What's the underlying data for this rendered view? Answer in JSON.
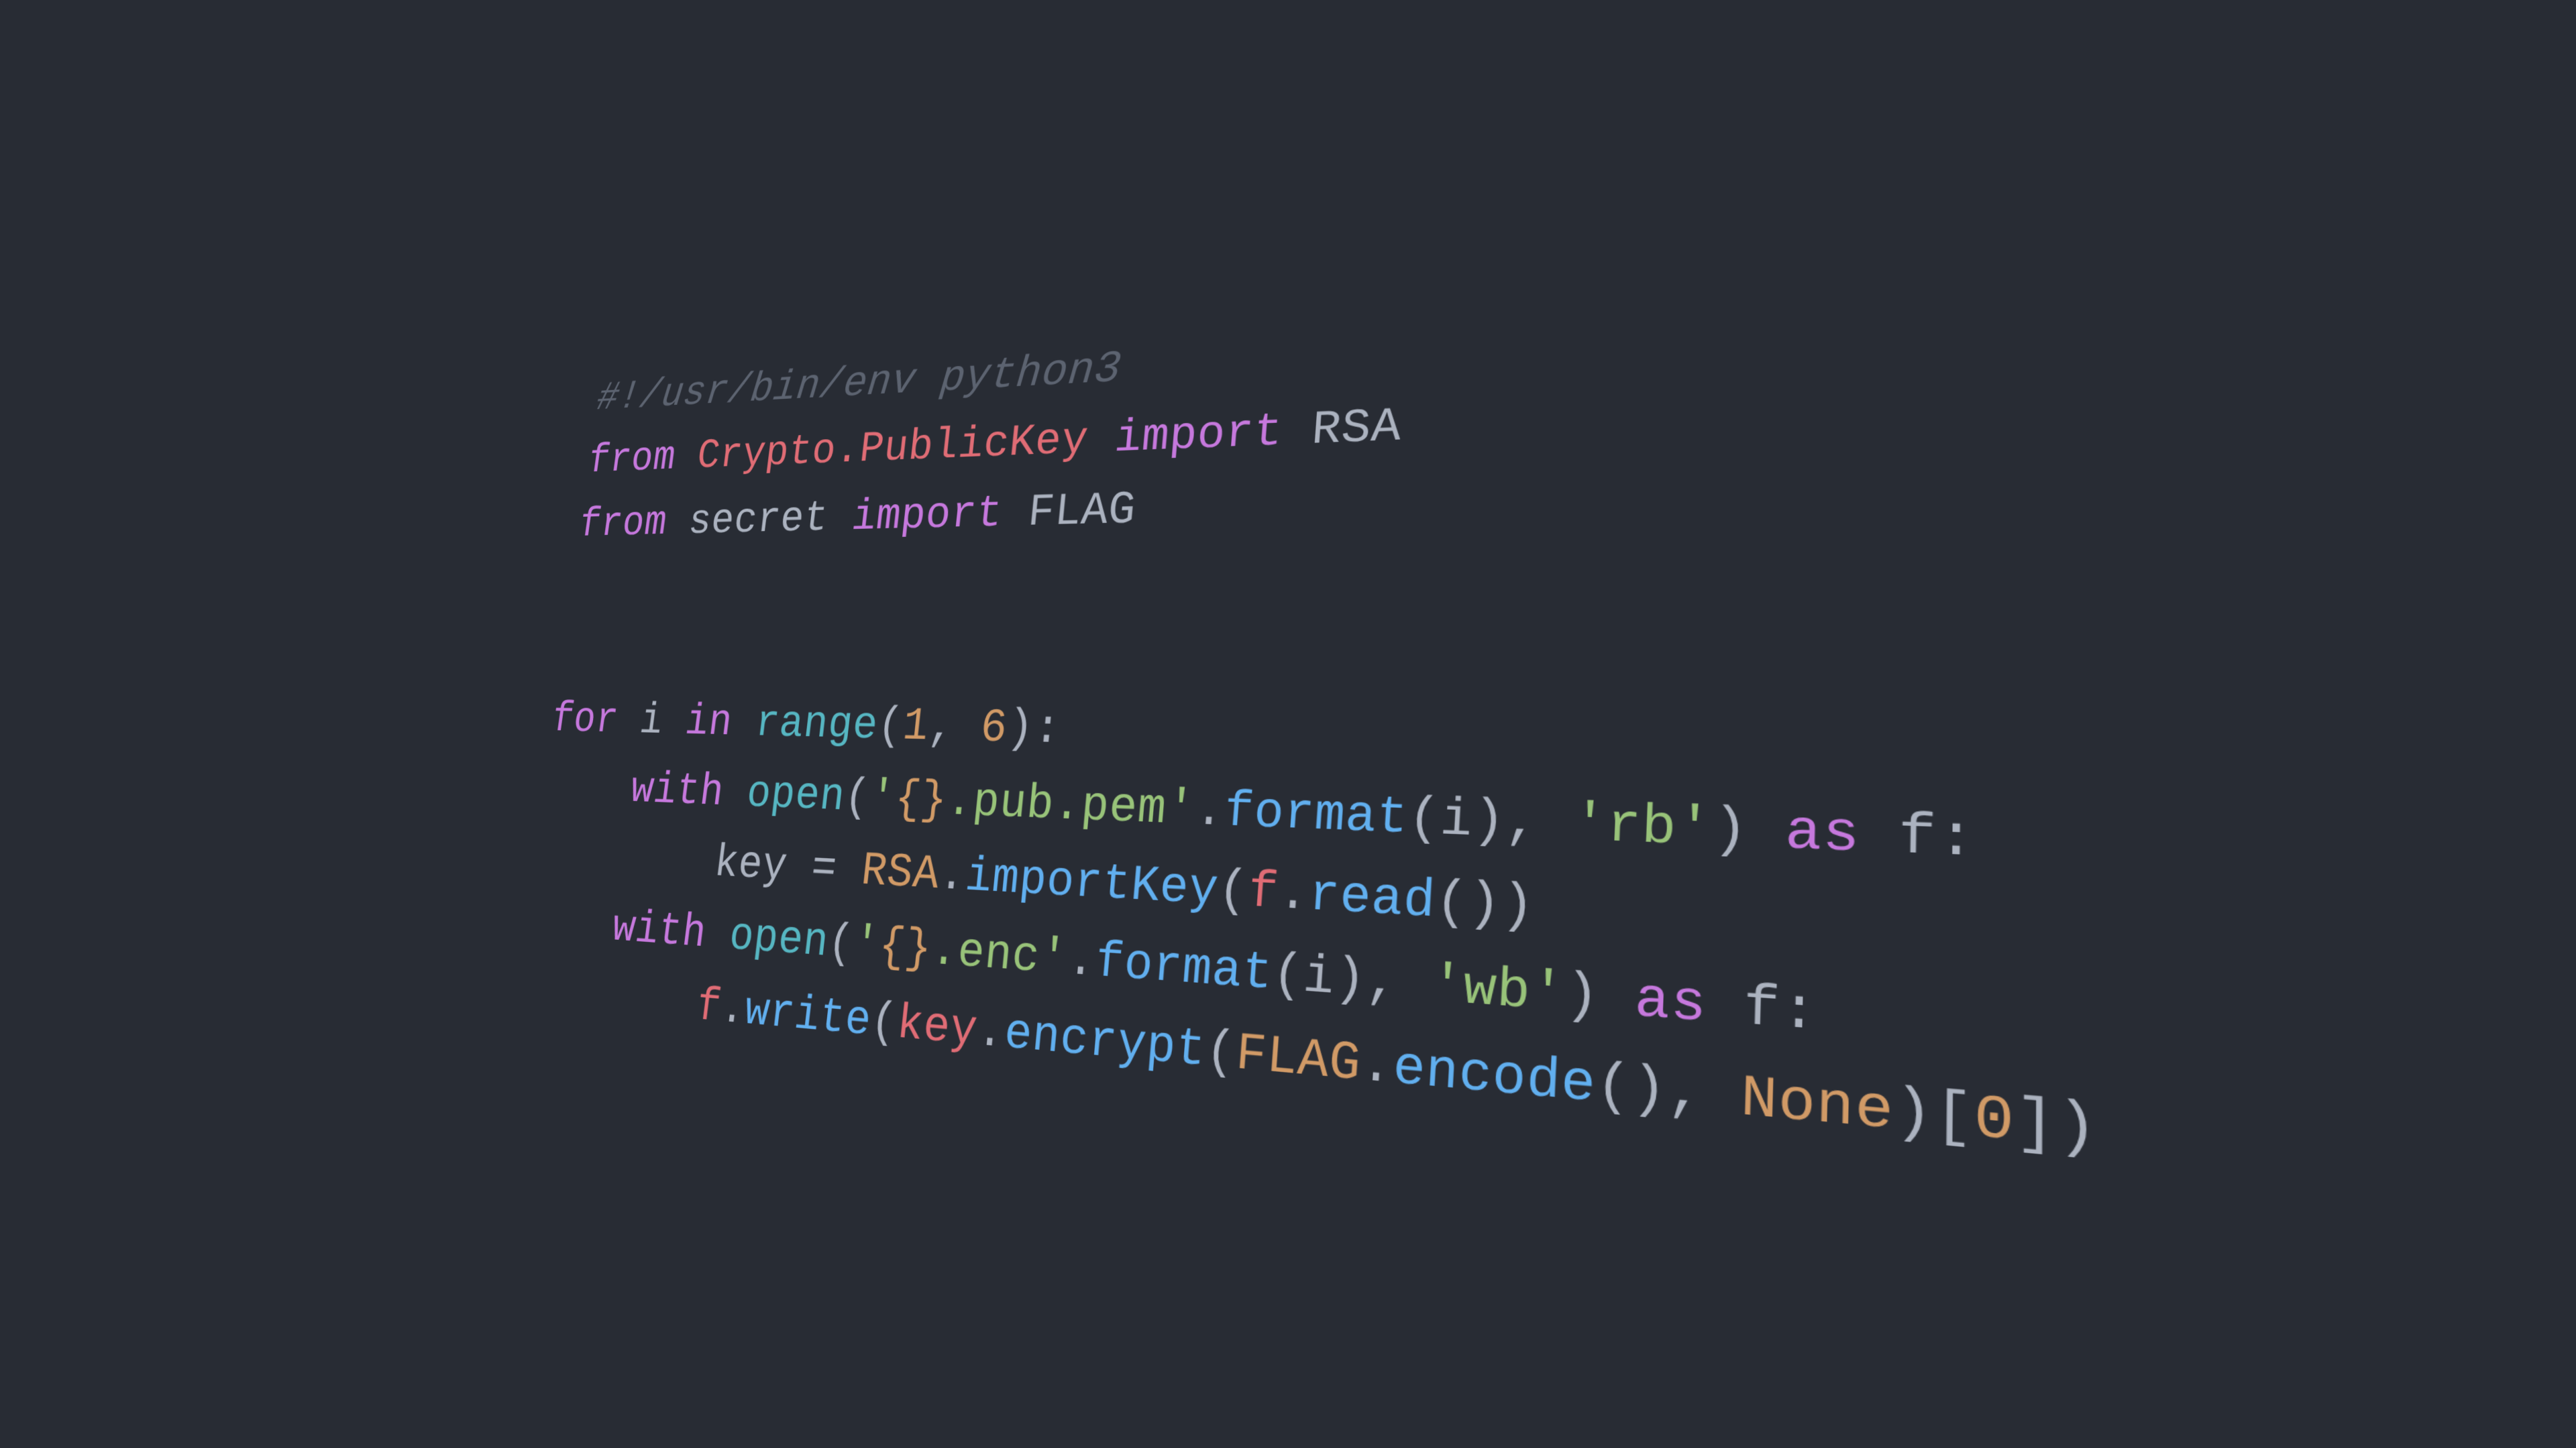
{
  "wallpaper": {
    "background_color": "#282c34",
    "language": "python",
    "theme": "one-dark"
  },
  "palette": {
    "background": "#282c34",
    "comment": "#5c6370",
    "keyword": "#c678dd",
    "module": "#e06c75",
    "variable": "#e06c75",
    "builtin": "#56b6c2",
    "function": "#61afef",
    "string": "#98c379",
    "number": "#d19a66",
    "constant": "#d19a66",
    "class": "#d19a66",
    "format_placeholder": "#d19a66",
    "default_text": "#abb2bf"
  },
  "code": {
    "full_text": "#!/usr/bin/env python3\nfrom Crypto.PublicKey import RSA\nfrom secret import FLAG\n\n\nfor i in range(1, 6):\n    with open('{}.pub.pem'.format(i), 'rb') as f:\n        key = RSA.importKey(f.read())\n    with open('{}.enc'.format(i), 'wb') as f:\n        f.write(key.encrypt(FLAG.encode(), None)[0])",
    "lines": [
      {
        "n": 1,
        "text": "#!/usr/bin/env python3",
        "tokens": [
          {
            "t": "#!/usr/bin/env python3",
            "c": "comment"
          }
        ]
      },
      {
        "n": 2,
        "text": "from Crypto.PublicKey import RSA",
        "tokens": [
          {
            "t": "from",
            "c": "keyword"
          },
          {
            "t": " ",
            "c": "plain"
          },
          {
            "t": "Crypto.PublicKey",
            "c": "module"
          },
          {
            "t": " ",
            "c": "plain"
          },
          {
            "t": "import",
            "c": "keyword"
          },
          {
            "t": " ",
            "c": "plain"
          },
          {
            "t": "RSA",
            "c": "plain"
          }
        ]
      },
      {
        "n": 3,
        "text": "from secret import FLAG",
        "tokens": [
          {
            "t": "from",
            "c": "keyword"
          },
          {
            "t": " ",
            "c": "plain"
          },
          {
            "t": "secret",
            "c": "plain"
          },
          {
            "t": " ",
            "c": "plain"
          },
          {
            "t": "import",
            "c": "keyword"
          },
          {
            "t": " ",
            "c": "plain"
          },
          {
            "t": "FLAG",
            "c": "plain"
          }
        ]
      },
      {
        "n": 4,
        "text": "",
        "tokens": []
      },
      {
        "n": 5,
        "text": "",
        "tokens": []
      },
      {
        "n": 6,
        "text": "for i in range(1, 6):",
        "tokens": [
          {
            "t": "for",
            "c": "keyword"
          },
          {
            "t": " ",
            "c": "plain"
          },
          {
            "t": "i",
            "c": "plain"
          },
          {
            "t": " ",
            "c": "plain"
          },
          {
            "t": "in",
            "c": "keyword"
          },
          {
            "t": " ",
            "c": "plain"
          },
          {
            "t": "range",
            "c": "builtin"
          },
          {
            "t": "(",
            "c": "punct"
          },
          {
            "t": "1",
            "c": "number"
          },
          {
            "t": ", ",
            "c": "punct"
          },
          {
            "t": "6",
            "c": "number"
          },
          {
            "t": "):",
            "c": "punct"
          }
        ]
      },
      {
        "n": 7,
        "text": "    with open('{}.pub.pem'.format(i), 'rb') as f:",
        "tokens": [
          {
            "t": "    ",
            "c": "plain"
          },
          {
            "t": "with",
            "c": "keyword"
          },
          {
            "t": " ",
            "c": "plain"
          },
          {
            "t": "open",
            "c": "builtin"
          },
          {
            "t": "(",
            "c": "punct"
          },
          {
            "t": "'",
            "c": "string"
          },
          {
            "t": "{}",
            "c": "fmt"
          },
          {
            "t": ".pub.pem'",
            "c": "string"
          },
          {
            "t": ".",
            "c": "punct"
          },
          {
            "t": "format",
            "c": "function"
          },
          {
            "t": "(",
            "c": "punct"
          },
          {
            "t": "i",
            "c": "plain"
          },
          {
            "t": "), ",
            "c": "punct"
          },
          {
            "t": "'rb'",
            "c": "string"
          },
          {
            "t": ") ",
            "c": "punct"
          },
          {
            "t": "as",
            "c": "keyword"
          },
          {
            "t": " ",
            "c": "plain"
          },
          {
            "t": "f",
            "c": "plain"
          },
          {
            "t": ":",
            "c": "punct"
          }
        ]
      },
      {
        "n": 8,
        "text": "        key = RSA.importKey(f.read())",
        "tokens": [
          {
            "t": "        ",
            "c": "plain"
          },
          {
            "t": "key",
            "c": "plain"
          },
          {
            "t": " ",
            "c": "plain"
          },
          {
            "t": "=",
            "c": "op"
          },
          {
            "t": " ",
            "c": "plain"
          },
          {
            "t": "RSA",
            "c": "class"
          },
          {
            "t": ".",
            "c": "punct"
          },
          {
            "t": "importKey",
            "c": "function"
          },
          {
            "t": "(",
            "c": "punct"
          },
          {
            "t": "f",
            "c": "var"
          },
          {
            "t": ".",
            "c": "punct"
          },
          {
            "t": "read",
            "c": "function"
          },
          {
            "t": "())",
            "c": "punct"
          }
        ]
      },
      {
        "n": 9,
        "text": "    with open('{}.enc'.format(i), 'wb') as f:",
        "tokens": [
          {
            "t": "    ",
            "c": "plain"
          },
          {
            "t": "with",
            "c": "keyword"
          },
          {
            "t": " ",
            "c": "plain"
          },
          {
            "t": "open",
            "c": "builtin"
          },
          {
            "t": "(",
            "c": "punct"
          },
          {
            "t": "'",
            "c": "string"
          },
          {
            "t": "{}",
            "c": "fmt"
          },
          {
            "t": ".enc'",
            "c": "string"
          },
          {
            "t": ".",
            "c": "punct"
          },
          {
            "t": "format",
            "c": "function"
          },
          {
            "t": "(",
            "c": "punct"
          },
          {
            "t": "i",
            "c": "plain"
          },
          {
            "t": "), ",
            "c": "punct"
          },
          {
            "t": "'wb'",
            "c": "string"
          },
          {
            "t": ") ",
            "c": "punct"
          },
          {
            "t": "as",
            "c": "keyword"
          },
          {
            "t": " ",
            "c": "plain"
          },
          {
            "t": "f",
            "c": "plain"
          },
          {
            "t": ":",
            "c": "punct"
          }
        ]
      },
      {
        "n": 10,
        "text": "        f.write(key.encrypt(FLAG.encode(), None)[0])",
        "tokens": [
          {
            "t": "        ",
            "c": "plain"
          },
          {
            "t": "f",
            "c": "var"
          },
          {
            "t": ".",
            "c": "punct"
          },
          {
            "t": "write",
            "c": "function"
          },
          {
            "t": "(",
            "c": "punct"
          },
          {
            "t": "key",
            "c": "var"
          },
          {
            "t": ".",
            "c": "punct"
          },
          {
            "t": "encrypt",
            "c": "function"
          },
          {
            "t": "(",
            "c": "punct"
          },
          {
            "t": "FLAG",
            "c": "class"
          },
          {
            "t": ".",
            "c": "punct"
          },
          {
            "t": "encode",
            "c": "function"
          },
          {
            "t": "(), ",
            "c": "punct"
          },
          {
            "t": "None",
            "c": "const"
          },
          {
            "t": ")[",
            "c": "punct"
          },
          {
            "t": "0",
            "c": "number"
          },
          {
            "t": "])",
            "c": "punct"
          }
        ]
      }
    ]
  }
}
